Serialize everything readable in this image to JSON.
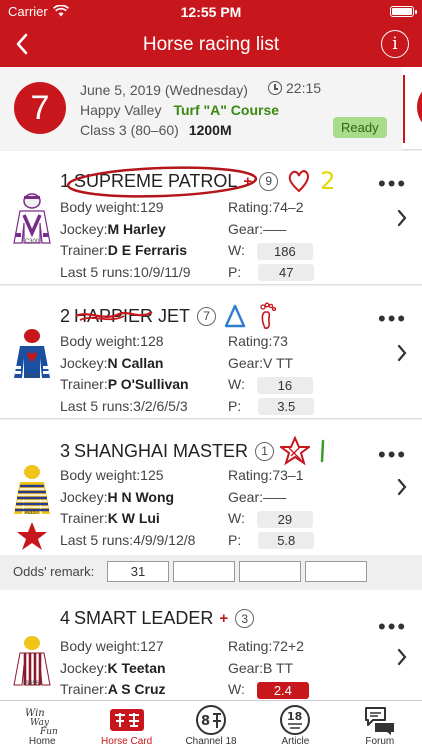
{
  "status": {
    "carrier": "Carrier",
    "time": "12:55 PM"
  },
  "nav": {
    "title": "Horse racing list",
    "info": "i"
  },
  "race": {
    "number": "7",
    "date": "June 5, 2019 (Wednesday)",
    "time": "22:15",
    "venue": "Happy Valley",
    "course": "Turf \"A\" Course",
    "class": "Class 3 (80–60)",
    "distance": "1200M",
    "status": "Ready"
  },
  "horses": [
    {
      "num": "1",
      "name": "SUPREME PATROL",
      "draw": "9",
      "body_weight": "Body weight:129",
      "jockey_label": "Jockey:",
      "jockey": "M Harley",
      "trainer_label": "Trainer:",
      "trainer": "D E Ferraris",
      "last5": "Last 5 runs:10/9/11/9",
      "rating": "Rating:74–2",
      "gear": "Gear:–––",
      "w_label": "W:",
      "w": "186",
      "p_label": "P:",
      "p": "47",
      "silk_code": "C300",
      "annotation_num": "2"
    },
    {
      "num": "2",
      "name": "HAPPIER JET",
      "draw": "7",
      "body_weight": "Body weight:128",
      "jockey_label": "Jockey:",
      "jockey": "N Callan",
      "trainer_label": "Trainer:",
      "trainer": "P O'Sullivan",
      "last5": "Last 5 runs:3/2/6/5/3",
      "rating": "Rating:73",
      "gear": "Gear:V TT",
      "w_label": "W:",
      "w": "16",
      "p_label": "P:",
      "p": "3.5",
      "silk_code": "T372"
    },
    {
      "num": "3",
      "name": "SHANGHAI MASTER",
      "draw": "1",
      "body_weight": "Body weight:125",
      "jockey_label": "Jockey:",
      "jockey": "H N Wong",
      "trainer_label": "Trainer:",
      "trainer": "K W Lui",
      "last5": "Last 5 runs:4/9/9/12/8",
      "rating": "Rating:73–1",
      "gear": "Gear:–––",
      "w_label": "W:",
      "w": "29",
      "p_label": "P:",
      "p": "5.8",
      "silk_code": "A337"
    },
    {
      "num": "4",
      "name": "SMART LEADER",
      "draw": "3",
      "body_weight": "Body weight:127",
      "jockey_label": "Jockey:",
      "jockey": "K Teetan",
      "trainer_label": "Trainer:",
      "trainer": "A S Cruz",
      "last5": "",
      "rating": "Rating:72+2",
      "gear": "Gear:B TT",
      "w_label": "W:",
      "w": "2.4",
      "silk_code": "B456"
    }
  ],
  "odds_remark": {
    "label": "Odds' remark:",
    "values": [
      "31",
      "",
      "",
      "",
      ""
    ]
  },
  "tabs": [
    {
      "label": "Home",
      "icon": "home-logo-icon"
    },
    {
      "label": "Horse Card",
      "icon": "horse-card-icon"
    },
    {
      "label": "Channel 18",
      "icon": "channel-18-icon"
    },
    {
      "label": "Article",
      "icon": "article-icon"
    },
    {
      "label": "Forum",
      "icon": "forum-icon"
    }
  ],
  "colors": {
    "brand": "#c8161d",
    "ready_bg": "#a6dc8a",
    "course": "#3a8a12"
  }
}
